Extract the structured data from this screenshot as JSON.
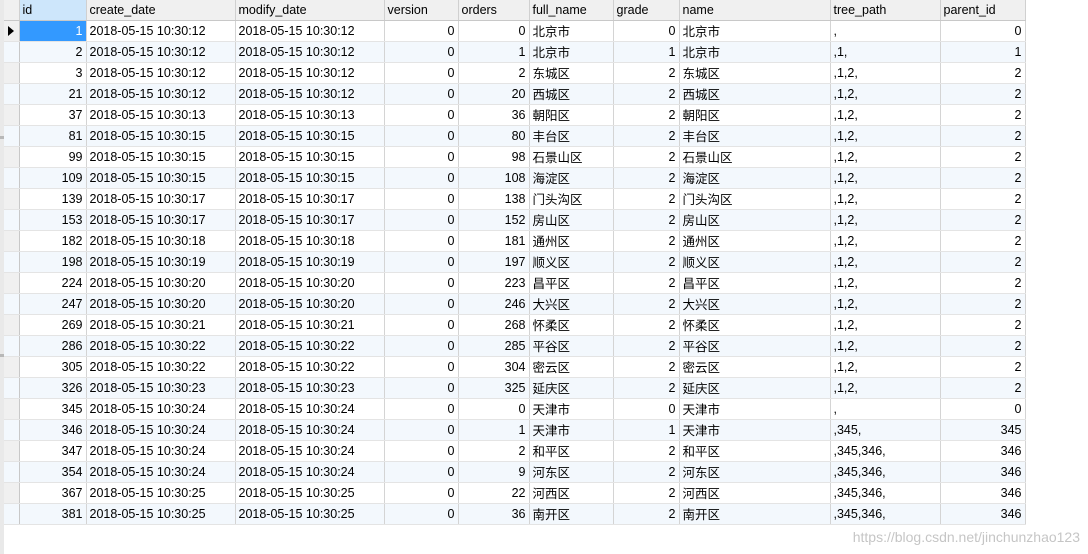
{
  "columns": [
    "id",
    "create_date",
    "modify_date",
    "version",
    "orders",
    "full_name",
    "grade",
    "name",
    "tree_path",
    "parent_id"
  ],
  "rows": [
    [
      "1",
      "2018-05-15 10:30:12",
      "2018-05-15 10:30:12",
      "0",
      "0",
      "北京市",
      "0",
      "北京市",
      ",",
      "0"
    ],
    [
      "2",
      "2018-05-15 10:30:12",
      "2018-05-15 10:30:12",
      "0",
      "1",
      "北京市",
      "1",
      "北京市",
      ",1,",
      "1"
    ],
    [
      "3",
      "2018-05-15 10:30:12",
      "2018-05-15 10:30:12",
      "0",
      "2",
      "东城区",
      "2",
      "东城区",
      ",1,2,",
      "2"
    ],
    [
      "21",
      "2018-05-15 10:30:12",
      "2018-05-15 10:30:12",
      "0",
      "20",
      "西城区",
      "2",
      "西城区",
      ",1,2,",
      "2"
    ],
    [
      "37",
      "2018-05-15 10:30:13",
      "2018-05-15 10:30:13",
      "0",
      "36",
      "朝阳区",
      "2",
      "朝阳区",
      ",1,2,",
      "2"
    ],
    [
      "81",
      "2018-05-15 10:30:15",
      "2018-05-15 10:30:15",
      "0",
      "80",
      "丰台区",
      "2",
      "丰台区",
      ",1,2,",
      "2"
    ],
    [
      "99",
      "2018-05-15 10:30:15",
      "2018-05-15 10:30:15",
      "0",
      "98",
      "石景山区",
      "2",
      "石景山区",
      ",1,2,",
      "2"
    ],
    [
      "109",
      "2018-05-15 10:30:15",
      "2018-05-15 10:30:15",
      "0",
      "108",
      "海淀区",
      "2",
      "海淀区",
      ",1,2,",
      "2"
    ],
    [
      "139",
      "2018-05-15 10:30:17",
      "2018-05-15 10:30:17",
      "0",
      "138",
      "门头沟区",
      "2",
      "门头沟区",
      ",1,2,",
      "2"
    ],
    [
      "153",
      "2018-05-15 10:30:17",
      "2018-05-15 10:30:17",
      "0",
      "152",
      "房山区",
      "2",
      "房山区",
      ",1,2,",
      "2"
    ],
    [
      "182",
      "2018-05-15 10:30:18",
      "2018-05-15 10:30:18",
      "0",
      "181",
      "通州区",
      "2",
      "通州区",
      ",1,2,",
      "2"
    ],
    [
      "198",
      "2018-05-15 10:30:19",
      "2018-05-15 10:30:19",
      "0",
      "197",
      "顺义区",
      "2",
      "顺义区",
      ",1,2,",
      "2"
    ],
    [
      "224",
      "2018-05-15 10:30:20",
      "2018-05-15 10:30:20",
      "0",
      "223",
      "昌平区",
      "2",
      "昌平区",
      ",1,2,",
      "2"
    ],
    [
      "247",
      "2018-05-15 10:30:20",
      "2018-05-15 10:30:20",
      "0",
      "246",
      "大兴区",
      "2",
      "大兴区",
      ",1,2,",
      "2"
    ],
    [
      "269",
      "2018-05-15 10:30:21",
      "2018-05-15 10:30:21",
      "0",
      "268",
      "怀柔区",
      "2",
      "怀柔区",
      ",1,2,",
      "2"
    ],
    [
      "286",
      "2018-05-15 10:30:22",
      "2018-05-15 10:30:22",
      "0",
      "285",
      "平谷区",
      "2",
      "平谷区",
      ",1,2,",
      "2"
    ],
    [
      "305",
      "2018-05-15 10:30:22",
      "2018-05-15 10:30:22",
      "0",
      "304",
      "密云区",
      "2",
      "密云区",
      ",1,2,",
      "2"
    ],
    [
      "326",
      "2018-05-15 10:30:23",
      "2018-05-15 10:30:23",
      "0",
      "325",
      "延庆区",
      "2",
      "延庆区",
      ",1,2,",
      "2"
    ],
    [
      "345",
      "2018-05-15 10:30:24",
      "2018-05-15 10:30:24",
      "0",
      "0",
      "天津市",
      "0",
      "天津市",
      ",",
      "0"
    ],
    [
      "346",
      "2018-05-15 10:30:24",
      "2018-05-15 10:30:24",
      "0",
      "1",
      "天津市",
      "1",
      "天津市",
      ",345,",
      "345"
    ],
    [
      "347",
      "2018-05-15 10:30:24",
      "2018-05-15 10:30:24",
      "0",
      "2",
      "和平区",
      "2",
      "和平区",
      ",345,346,",
      "346"
    ],
    [
      "354",
      "2018-05-15 10:30:24",
      "2018-05-15 10:30:24",
      "0",
      "9",
      "河东区",
      "2",
      "河东区",
      ",345,346,",
      "346"
    ],
    [
      "367",
      "2018-05-15 10:30:25",
      "2018-05-15 10:30:25",
      "0",
      "22",
      "河西区",
      "2",
      "河西区",
      ",345,346,",
      "346"
    ],
    [
      "381",
      "2018-05-15 10:30:25",
      "2018-05-15 10:30:25",
      "0",
      "36",
      "南开区",
      "2",
      "南开区",
      ",345,346,",
      "346"
    ]
  ],
  "current_row_indicator": "row-arrow-icon",
  "watermark": "https://blog.csdn.net/jinchunzhao123",
  "colors": {
    "selected_cell": "#3399ff",
    "selected_header": "#cde6fb",
    "alt_row": "#f3f8fd",
    "header_bg": "#f0f0f0"
  }
}
